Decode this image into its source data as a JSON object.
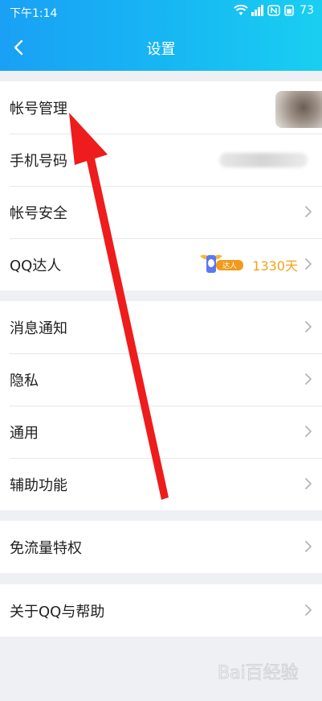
{
  "status_bar": {
    "time": "下午1:14",
    "battery": "73"
  },
  "nav": {
    "title": "设置"
  },
  "groups": [
    {
      "items": [
        {
          "label": "帐号管理"
        },
        {
          "label": "手机号码"
        },
        {
          "label": "帐号安全"
        },
        {
          "label": "QQ达人",
          "value": "1330天",
          "badge_text": "达人"
        }
      ]
    },
    {
      "items": [
        {
          "label": "消息通知"
        },
        {
          "label": "隐私"
        },
        {
          "label": "通用"
        },
        {
          "label": "辅助功能"
        }
      ]
    },
    {
      "items": [
        {
          "label": "免流量特权"
        }
      ]
    },
    {
      "items": [
        {
          "label": "关于QQ与帮助"
        }
      ]
    }
  ],
  "watermark": "Bai百经验",
  "colors": {
    "header_start": "#1aa0f5",
    "header_end": "#19cff1",
    "accent_orange": "#f4a318",
    "annotation_red": "#ee1c1c"
  }
}
